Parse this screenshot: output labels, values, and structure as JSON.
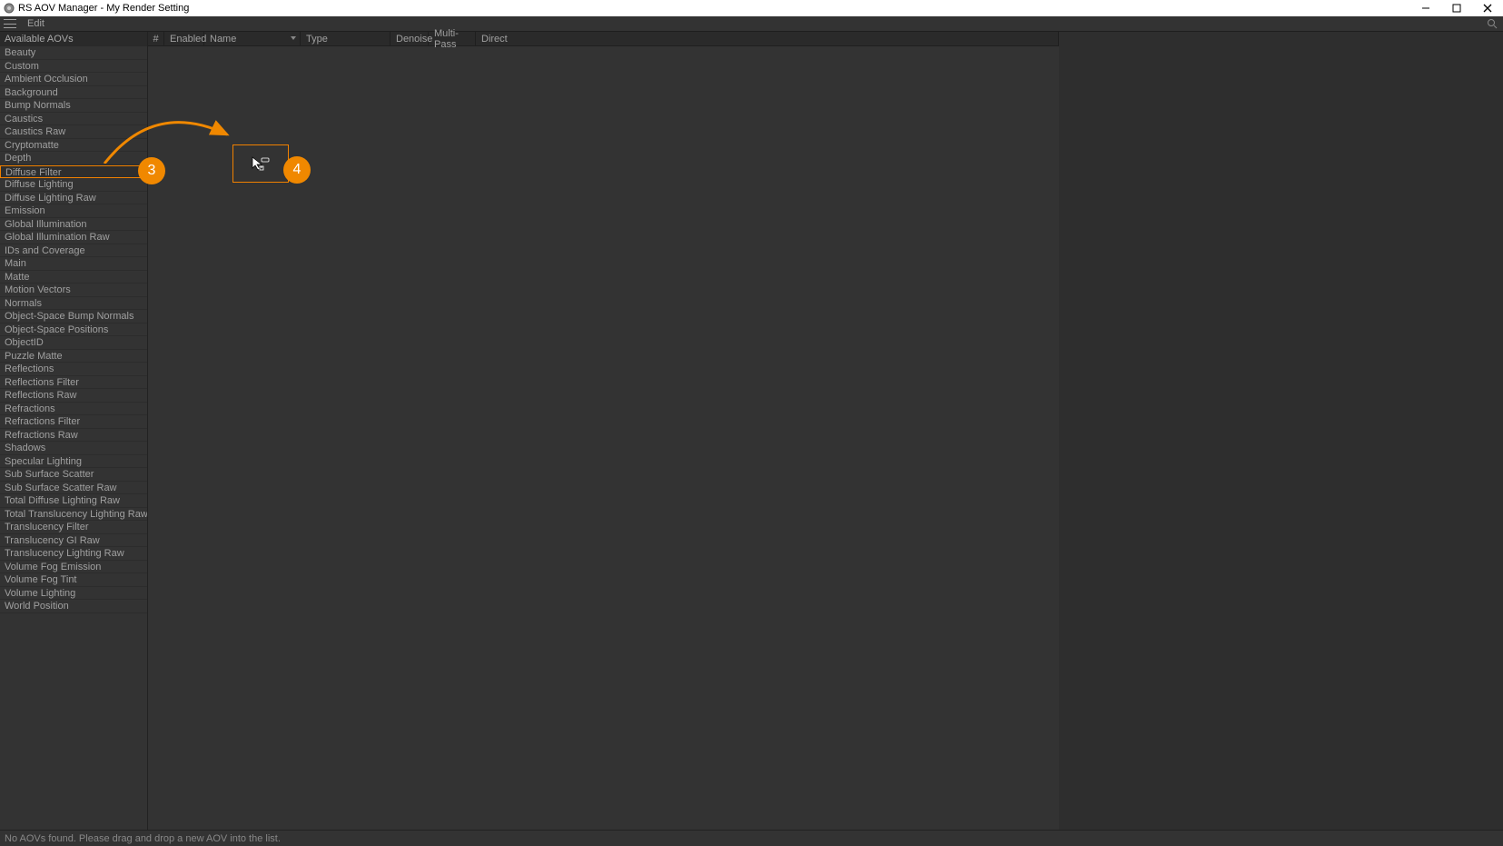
{
  "window": {
    "title": "RS AOV Manager - My Render Setting"
  },
  "menu": {
    "edit": "Edit"
  },
  "sidebar": {
    "header": "Available AOVs",
    "items": [
      "Beauty",
      "Custom",
      "Ambient Occlusion",
      "Background",
      "Bump Normals",
      "Caustics",
      "Caustics Raw",
      "Cryptomatte",
      "Depth",
      "Diffuse Filter",
      "Diffuse Lighting",
      "Diffuse Lighting Raw",
      "Emission",
      "Global Illumination",
      "Global Illumination Raw",
      "IDs and Coverage",
      "Main",
      "Matte",
      "Motion Vectors",
      "Normals",
      "Object-Space Bump Normals",
      "Object-Space Positions",
      "ObjectID",
      "Puzzle Matte",
      "Reflections",
      "Reflections Filter",
      "Reflections Raw",
      "Refractions",
      "Refractions Filter",
      "Refractions Raw",
      "Shadows",
      "Specular Lighting",
      "Sub Surface Scatter",
      "Sub Surface Scatter Raw",
      "Total Diffuse Lighting Raw",
      "Total Translucency Lighting Raw",
      "Translucency Filter",
      "Translucency GI Raw",
      "Translucency Lighting Raw",
      "Volume Fog Emission",
      "Volume Fog Tint",
      "Volume Lighting",
      "World Position"
    ],
    "highlighted_index": 9
  },
  "table": {
    "columns": {
      "num": "#",
      "enabled": "Enabled",
      "name": "Name",
      "type": "Type",
      "denoise": "Denoise",
      "multipass": "Multi-Pass",
      "direct": "Direct"
    }
  },
  "annotations": {
    "badge3": "3",
    "badge4": "4"
  },
  "status": {
    "message": "No AOVs found. Please drag and drop a new AOV into the list."
  }
}
